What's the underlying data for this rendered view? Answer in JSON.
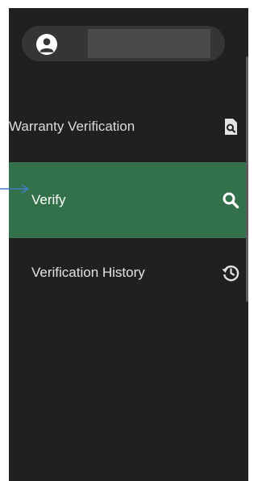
{
  "sidebar": {
    "user": {
      "avatar_icon": "account-circle-icon",
      "name": ""
    },
    "items": [
      {
        "label": "Warranty Verification",
        "icon": "document-search-icon",
        "active": false
      },
      {
        "label": "Verify",
        "icon": "search-icon",
        "active": true
      },
      {
        "label": "Verification History",
        "icon": "history-icon",
        "active": false
      }
    ]
  },
  "colors": {
    "sidebar_bg": "#202020",
    "active_bg": "#32714a",
    "text": "#e3e3e3",
    "arrow": "#3f7fc4"
  }
}
